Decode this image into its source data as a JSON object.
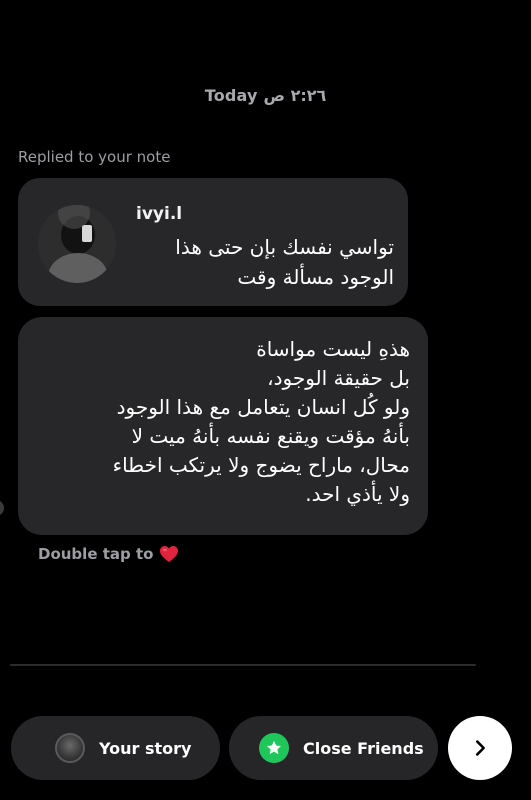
{
  "header": {
    "timestamp": "Today ٢:٢٦ ص"
  },
  "note_reply": {
    "label": "Replied to your note",
    "username": "ivyi.l",
    "note_text": "تواسي نفسك بإن حتى هذا الوجود مسألة وقت"
  },
  "message": {
    "lines": [
      "هذهِ ليست مواساة",
      "بل حقيقة الوجود،",
      "ولو كُل انسان يتعامل مع هذا الوجود",
      "بأنهُ مؤقت ويقنع نفسه بأنهُ ميت لا",
      "محال، ماراح يضوج ولا يرتكب اخطاء",
      "ولا يأذي احد."
    ]
  },
  "reaction_hint": {
    "text": "Double tap to"
  },
  "share_bar": {
    "your_story_label": "Your story",
    "close_friends_label": "Close Friends"
  },
  "colors": {
    "background": "#000000",
    "bubble": "#27272a",
    "close_friends_green": "#1fc75b",
    "heart_red": "#e0243d"
  },
  "icons": {
    "heart": "heart-icon",
    "star": "star-icon",
    "next": "chevron-right-icon"
  }
}
